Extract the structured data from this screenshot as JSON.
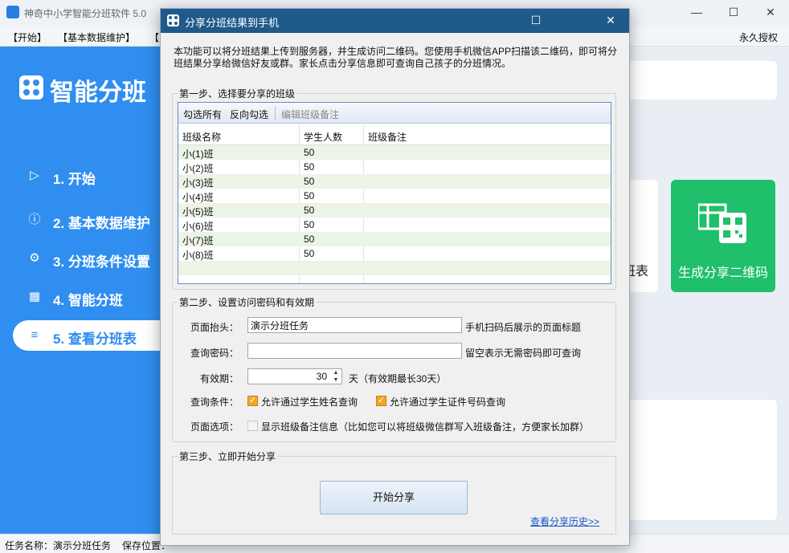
{
  "main_window": {
    "title": "神奇中小学智能分班软件 5.0",
    "minimize": "—",
    "maximize": "☐",
    "close": "✕"
  },
  "menubar": {
    "items": [
      "【开始】",
      "【基本数据维护】",
      "【"
    ],
    "right": "永久授权"
  },
  "sidebar": {
    "brand": "智能分班",
    "nav": [
      {
        "label": "1. 开始",
        "icon": "play-icon"
      },
      {
        "label": "2. 基本数据维护",
        "icon": "info-icon"
      },
      {
        "label": "3. 分班条件设置",
        "icon": "gear-icon"
      },
      {
        "label": "4. 智能分班",
        "icon": "grid-icon"
      },
      {
        "label": "5. 查看分班表",
        "icon": "search-list-icon"
      }
    ]
  },
  "right_panel": {
    "card_partial_label": "班表",
    "card_green_label": "生成分享二维码"
  },
  "statusbar": {
    "task": "任务名称：演示分班任务",
    "save": "保存位置："
  },
  "dialog": {
    "title": "分享分班结果到手机",
    "maximize": "☐",
    "close": "✕",
    "intro": "本功能可以将分班结果上传到服务器，并生成访问二维码。您使用手机微信APP扫描该二维码，即可将分班结果分享给微信好友或群。家长点击分享信息即可查询自己孩子的分班情况。",
    "step1": {
      "title": "第一步、选择要分享的班级",
      "toolbar": {
        "select_all": "勾选所有",
        "invert": "反向勾选",
        "edit_note": "编辑班级备注"
      },
      "columns": [
        "班级名称",
        "学生人数",
        "班级备注"
      ],
      "rows": [
        {
          "name": "小(1)班",
          "count": "50",
          "note": ""
        },
        {
          "name": "小(2)班",
          "count": "50",
          "note": ""
        },
        {
          "name": "小(3)班",
          "count": "50",
          "note": ""
        },
        {
          "name": "小(4)班",
          "count": "50",
          "note": ""
        },
        {
          "name": "小(5)班",
          "count": "50",
          "note": ""
        },
        {
          "name": "小(6)班",
          "count": "50",
          "note": ""
        },
        {
          "name": "小(7)班",
          "count": "50",
          "note": ""
        },
        {
          "name": "小(8)班",
          "count": "50",
          "note": ""
        }
      ]
    },
    "step2": {
      "title": "第二步、设置访问密码和有效期",
      "header_label": "页面抬头：",
      "header_value": "演示分班任务",
      "header_hint": "手机扫码后展示的页面标题",
      "password_label": "查询密码：",
      "password_value": "",
      "password_hint": "留空表示无需密码即可查询",
      "validity_label": "有效期：",
      "validity_value": "30",
      "validity_hint": "天（有效期最长30天）",
      "query_label": "查询条件：",
      "query_name": "允许通过学生姓名查询",
      "query_id": "允许通过学生证件号码查询",
      "page_label": "页面选项：",
      "page_option": "显示班级备注信息（比如您可以将班级微信群写入班级备注，方便家长加群）"
    },
    "step3": {
      "title": "第三步、立即开始分享",
      "start_button": "开始分享",
      "history_link": "查看分享历史>>"
    }
  }
}
